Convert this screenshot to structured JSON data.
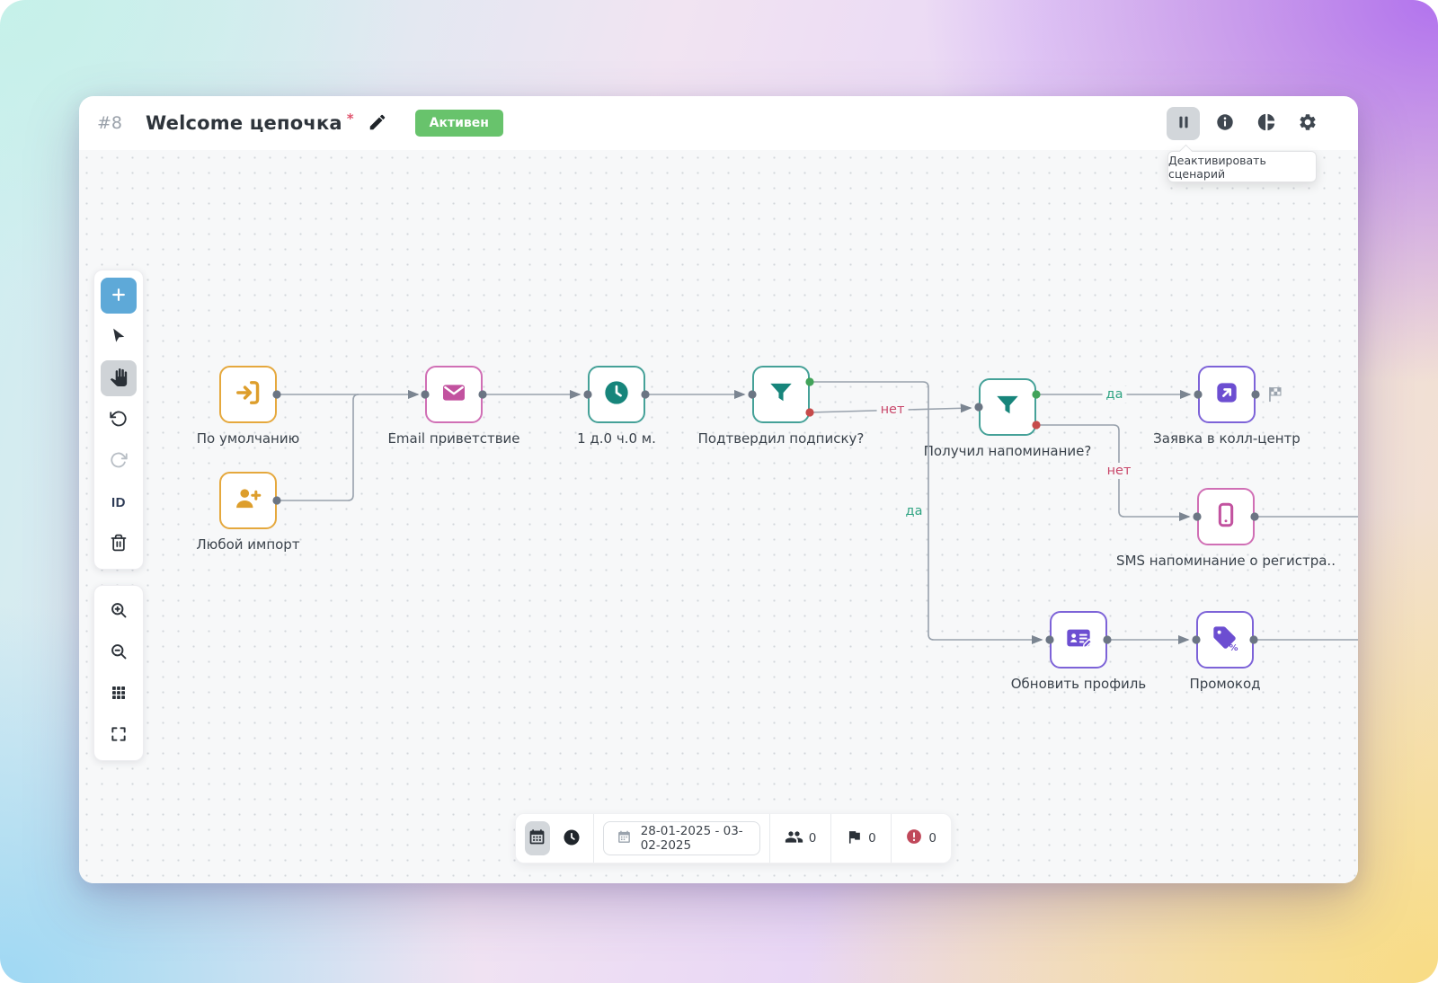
{
  "header": {
    "scenario_number": "#8",
    "title": "Welcome цепочка",
    "required_asterisk": "*",
    "status_badge": "Активен",
    "actions_tooltip": "Деактивировать сценарий"
  },
  "left_toolbar": {
    "id_label": "ID"
  },
  "flow": {
    "nodes": [
      {
        "label": "По умолчанию",
        "icon": "sign-in-icon",
        "color": "yellow"
      },
      {
        "label": "Любой импорт",
        "icon": "person-plus-icon",
        "color": "yellow"
      },
      {
        "label": "Email приветствие",
        "icon": "envelope-icon",
        "color": "pink"
      },
      {
        "label": "1 д.0 ч.0 м.",
        "icon": "clock-icon",
        "color": "teal"
      },
      {
        "label": "Подтвердил подписку?",
        "icon": "funnel-icon",
        "color": "teal"
      },
      {
        "label": "Получил напоминание?",
        "icon": "funnel-icon",
        "color": "teal"
      },
      {
        "label": "Заявка в колл-центр",
        "icon": "arrow-up-right-square-icon",
        "color": "purple"
      },
      {
        "label": "SMS напоминание о регистра..",
        "icon": "smartphone-icon",
        "color": "pink"
      },
      {
        "label": "Обновить профиль",
        "icon": "contact-card-edit-icon",
        "color": "purple"
      },
      {
        "label": "Промокод",
        "icon": "promo-tag-icon",
        "color": "purple"
      }
    ],
    "edge_labels": {
      "confirmed_no": "нет",
      "confirmed_yes": "да",
      "reminder_yes": "да",
      "reminder_no": "нет"
    }
  },
  "footer": {
    "date_range": "28-01-2025 - 03-02-2025",
    "contacts_count": "0",
    "goals_count": "0",
    "errors_count": "0"
  },
  "colors": {
    "status_green": "#68c36c",
    "node_yellow": "#e5a83d",
    "node_pink": "#d06fb5",
    "node_teal": "#45a198",
    "node_purple": "#7d63d8",
    "edge_yes": "#2fa382",
    "edge_no": "#c9486b",
    "port_green": "#42a35a",
    "port_red": "#c64b4b"
  }
}
